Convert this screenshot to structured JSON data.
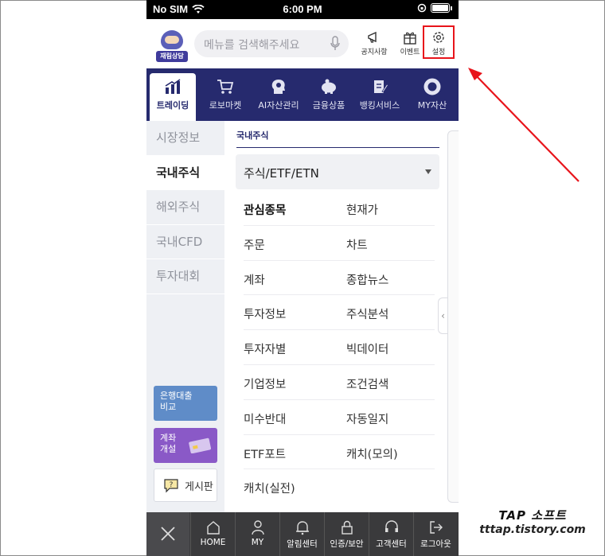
{
  "status_bar": {
    "carrier": "No SIM",
    "time": "6:00 PM"
  },
  "header": {
    "logo_text": "재림상담",
    "search_placeholder": "메뉴를 검색해주세요",
    "notice_label": "공지사항",
    "event_label": "이벤트",
    "settings_label": "설정"
  },
  "top_nav": [
    {
      "label": "트레이딩",
      "icon": "bar-chart-icon",
      "active": true
    },
    {
      "label": "로보마켓",
      "icon": "cart-icon"
    },
    {
      "label": "AI자산관리",
      "icon": "ai-head-icon"
    },
    {
      "label": "금융상품",
      "icon": "piggy-bank-icon"
    },
    {
      "label": "뱅킹서비스",
      "icon": "document-pen-icon"
    },
    {
      "label": "MY자산",
      "icon": "donut-chart-icon"
    }
  ],
  "left_nav": [
    {
      "label": "시장정보"
    },
    {
      "label": "국내주식",
      "active": true
    },
    {
      "label": "해외주식"
    },
    {
      "label": "국내CFD"
    },
    {
      "label": "투자대회"
    }
  ],
  "promos": {
    "loan": "은행대출\n비교",
    "account": "계좌\n개설",
    "board": "게시판"
  },
  "main": {
    "breadcrumb": "국내주식",
    "dropdown_value": "주식/ETF/ETN",
    "menu_rows": [
      [
        "관심종목",
        "현재가"
      ],
      [
        "주문",
        "차트"
      ],
      [
        "계좌",
        "종합뉴스"
      ],
      [
        "투자정보",
        "주식분석"
      ],
      [
        "투자자별",
        "빅데이터"
      ],
      [
        "기업정보",
        "조건검색"
      ],
      [
        "미수반대",
        "자동일지"
      ],
      [
        "ETF포트",
        "캐치(모의)"
      ],
      [
        "캐치(실전)",
        ""
      ]
    ]
  },
  "bottom_nav": [
    {
      "label": "HOME",
      "icon": "home-icon"
    },
    {
      "label": "MY",
      "icon": "person-icon"
    },
    {
      "label": "알림센터",
      "icon": "bell-icon"
    },
    {
      "label": "인증/보안",
      "icon": "lock-icon"
    },
    {
      "label": "고객센터",
      "icon": "headset-icon"
    },
    {
      "label": "로그아웃",
      "icon": "logout-icon"
    }
  ],
  "watermark": {
    "line1": "TAP 소프트",
    "line2": "tttap.tistory.com"
  },
  "colors": {
    "nav_bg": "#262a6e",
    "highlight": "#e8141b",
    "bottom_bg": "#3a3a3c"
  }
}
